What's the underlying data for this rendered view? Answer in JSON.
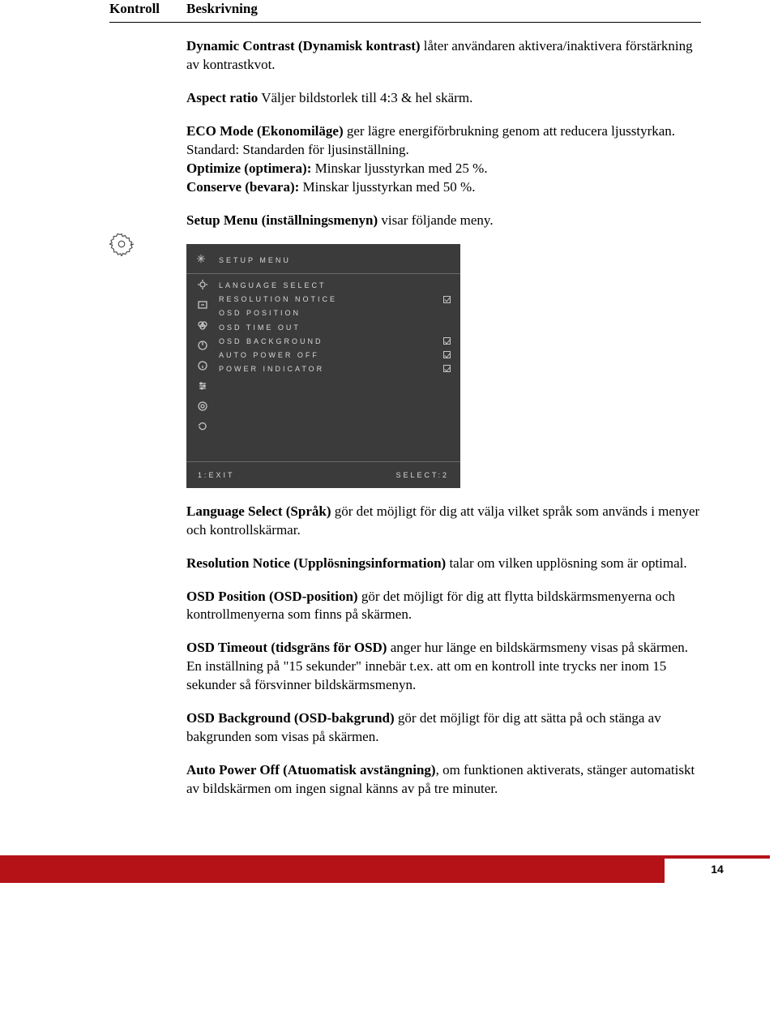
{
  "header": {
    "kontroll": "Kontroll",
    "beskrivning": "Beskrivning"
  },
  "paras": {
    "p1": {
      "bold": "Dynamic Contrast (Dynamisk kontrast)",
      "text": " låter användaren aktivera/inaktivera förstärkning av kontrastkvot."
    },
    "p2": {
      "bold": "Aspect ratio",
      "text": " Väljer bildstorlek till 4:3 & hel skärm."
    },
    "p3": {
      "bold": "ECO Mode (Ekonomiläge)",
      "text": " ger lägre energiförbrukning genom att reducera ljusstyrkan."
    },
    "p3a": "Standard: Standarden för ljusinställning.",
    "p3b": {
      "bold": "Optimize (optimera):",
      "text": " Minskar ljusstyrkan med 25 %."
    },
    "p3c": {
      "bold": "Conserve (bevara):",
      "text": " Minskar ljusstyrkan med 50 %."
    },
    "p4": {
      "bold": "Setup Menu (inställningsmenyn)",
      "text": " visar följande meny."
    },
    "p5": {
      "bold": "Language Select (Språk)",
      "text": " gör det möjligt för dig att välja vilket språk som används i menyer och kontrollskärmar."
    },
    "p6": {
      "bold": "Resolution Notice (Upplösningsinformation)",
      "text": " talar om vilken upplösning som är optimal."
    },
    "p7": {
      "bold": "OSD Position (OSD-position)",
      "text": " gör det möjligt för dig att flytta bildskärmsmenyerna och kontrollmenyerna som finns på skärmen."
    },
    "p8": {
      "bold": "OSD Timeout (tidsgräns för OSD)",
      "text": " anger hur länge en bildskärmsmeny visas på skärmen. En inställning på \"15 sekunder\" innebär t.ex. att om en kontroll inte trycks ner inom 15 sekunder så försvinner bildskärmsmenyn."
    },
    "p9": {
      "bold": "OSD Background (OSD-bakgrund)",
      "text": " gör det möjligt för dig att sätta på och stänga av bakgrunden som visas på skärmen."
    },
    "p10": {
      "bold": "Auto Power Off (Atuomatisk avstängning)",
      "text": ", om funktionen aktiverats, stänger automatiskt av bildskärmen om ingen signal känns av på tre minuter."
    }
  },
  "osd": {
    "title": "SETUP MENU",
    "items": [
      {
        "label": "LANGUAGE SELECT",
        "check": false
      },
      {
        "label": "RESOLUTION NOTICE",
        "check": true
      },
      {
        "label": "OSD POSITION",
        "check": false
      },
      {
        "label": "OSD TIME OUT",
        "check": false
      },
      {
        "label": "OSD BACKGROUND",
        "check": true
      },
      {
        "label": "AUTO POWER OFF",
        "check": true
      },
      {
        "label": "POWER INDICATOR",
        "check": true
      }
    ],
    "footer_left": "1:EXIT",
    "footer_right": "SELECT:2"
  },
  "page_number": "14"
}
